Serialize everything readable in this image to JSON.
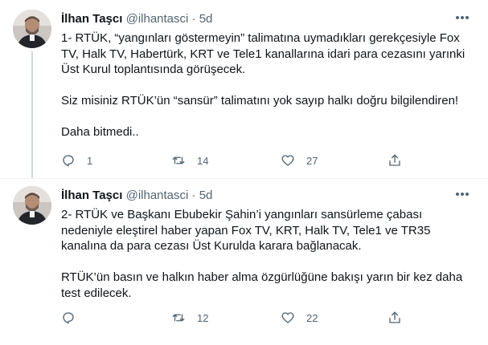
{
  "tweets": [
    {
      "name": "İlhan Taşcı",
      "handle": "@ilhantasci",
      "separator": "·",
      "time": "5d",
      "paragraphs": [
        "1- RTÜK, “yangınları göstermeyin” talimatına uymadıkları gerekçesiyle Fox TV, Halk TV, Habertürk, KRT ve Tele1 kanallarına idari para cezasını yarınki Üst Kurul toplantısında görüşecek.",
        "Siz misiniz RTÜK’ün “sansür” talimatını yok sayıp halkı doğru bilgilendiren!",
        "Daha bitmedi.."
      ],
      "replies": "1",
      "retweets": "14",
      "likes": "27"
    },
    {
      "name": "İlhan Taşcı",
      "handle": "@ilhantasci",
      "separator": "·",
      "time": "5d",
      "paragraphs": [
        "2- RTÜK ve Başkanı Ebubekir Şahin’i yangınları sansürleme çabası nedeniyle eleştirel haber yapan Fox TV, KRT, Halk TV, Tele1 ve TR35 kanalına da para cezası Üst Kurulda karara bağlanacak.",
        "RTÜK’ün basın ve halkın haber alma özgürlüğüne bakışı yarın bir kez daha test edilecek."
      ],
      "replies": "",
      "retweets": "12",
      "likes": "22"
    }
  ],
  "icons": {
    "more": "more-dots-icon",
    "reply": "reply-icon",
    "retweet": "retweet-icon",
    "like": "like-icon",
    "share": "share-icon"
  },
  "colors": {
    "text": "#0f1419",
    "secondary": "#536471",
    "thread_line": "#cfd9de",
    "divider": "#eff3f4"
  }
}
